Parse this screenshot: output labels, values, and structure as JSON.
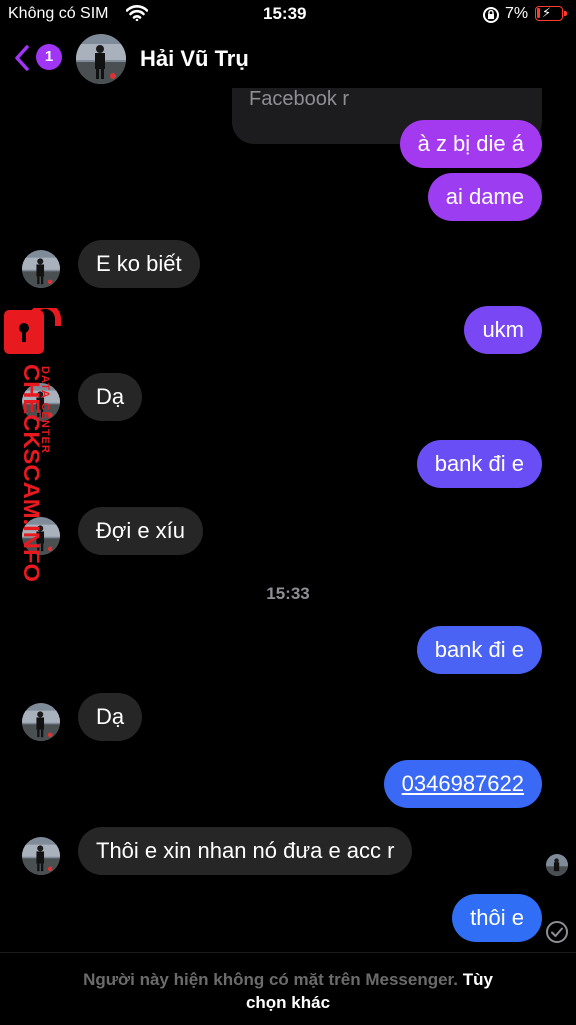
{
  "status_bar": {
    "carrier": "Không có SIM",
    "time": "15:39",
    "battery_percent": "7%"
  },
  "header": {
    "unread_count": "1",
    "contact_name": "Hải Vũ Trụ"
  },
  "conversation": {
    "reply_preview": "Facebook r",
    "messages": [
      {
        "from": "me",
        "text": "à z bị die á"
      },
      {
        "from": "me",
        "text": "ai dame"
      },
      {
        "from": "them",
        "text": "E ko biết"
      },
      {
        "from": "me",
        "text": "ukm"
      },
      {
        "from": "them",
        "text": "Dạ"
      },
      {
        "from": "me",
        "text": "bank đi e"
      },
      {
        "from": "them",
        "text": "Đợi e xíu"
      },
      {
        "from": "me",
        "text": "bank đi e"
      },
      {
        "from": "them",
        "text": "Dạ"
      },
      {
        "from": "me",
        "text": "0346987622"
      },
      {
        "from": "them",
        "text": "Thôi e xin nhan nó đưa e acc r"
      },
      {
        "from": "me",
        "text": "thôi e"
      }
    ],
    "timestamp": "15:33"
  },
  "watermark": {
    "main": "CHECKSCAM.INFO",
    "sub": "DATA CENTER"
  },
  "footer": {
    "notice": "Người này hiện không có mặt trên Messenger.",
    "action_part1": "Tùy",
    "action_part2": "chọn khác"
  },
  "colors": {
    "accent_purple": "#a135f5",
    "bubble_top": "#a438f0",
    "bubble_mid": "#6e4cf5",
    "bubble_bottom": "#2f6ef5",
    "incoming": "#262626",
    "watermark_red": "#e8191f"
  },
  "icons": [
    "wifi-icon",
    "rotation-lock-icon",
    "battery-icon",
    "back-chevron-icon",
    "sent-check-icon"
  ]
}
